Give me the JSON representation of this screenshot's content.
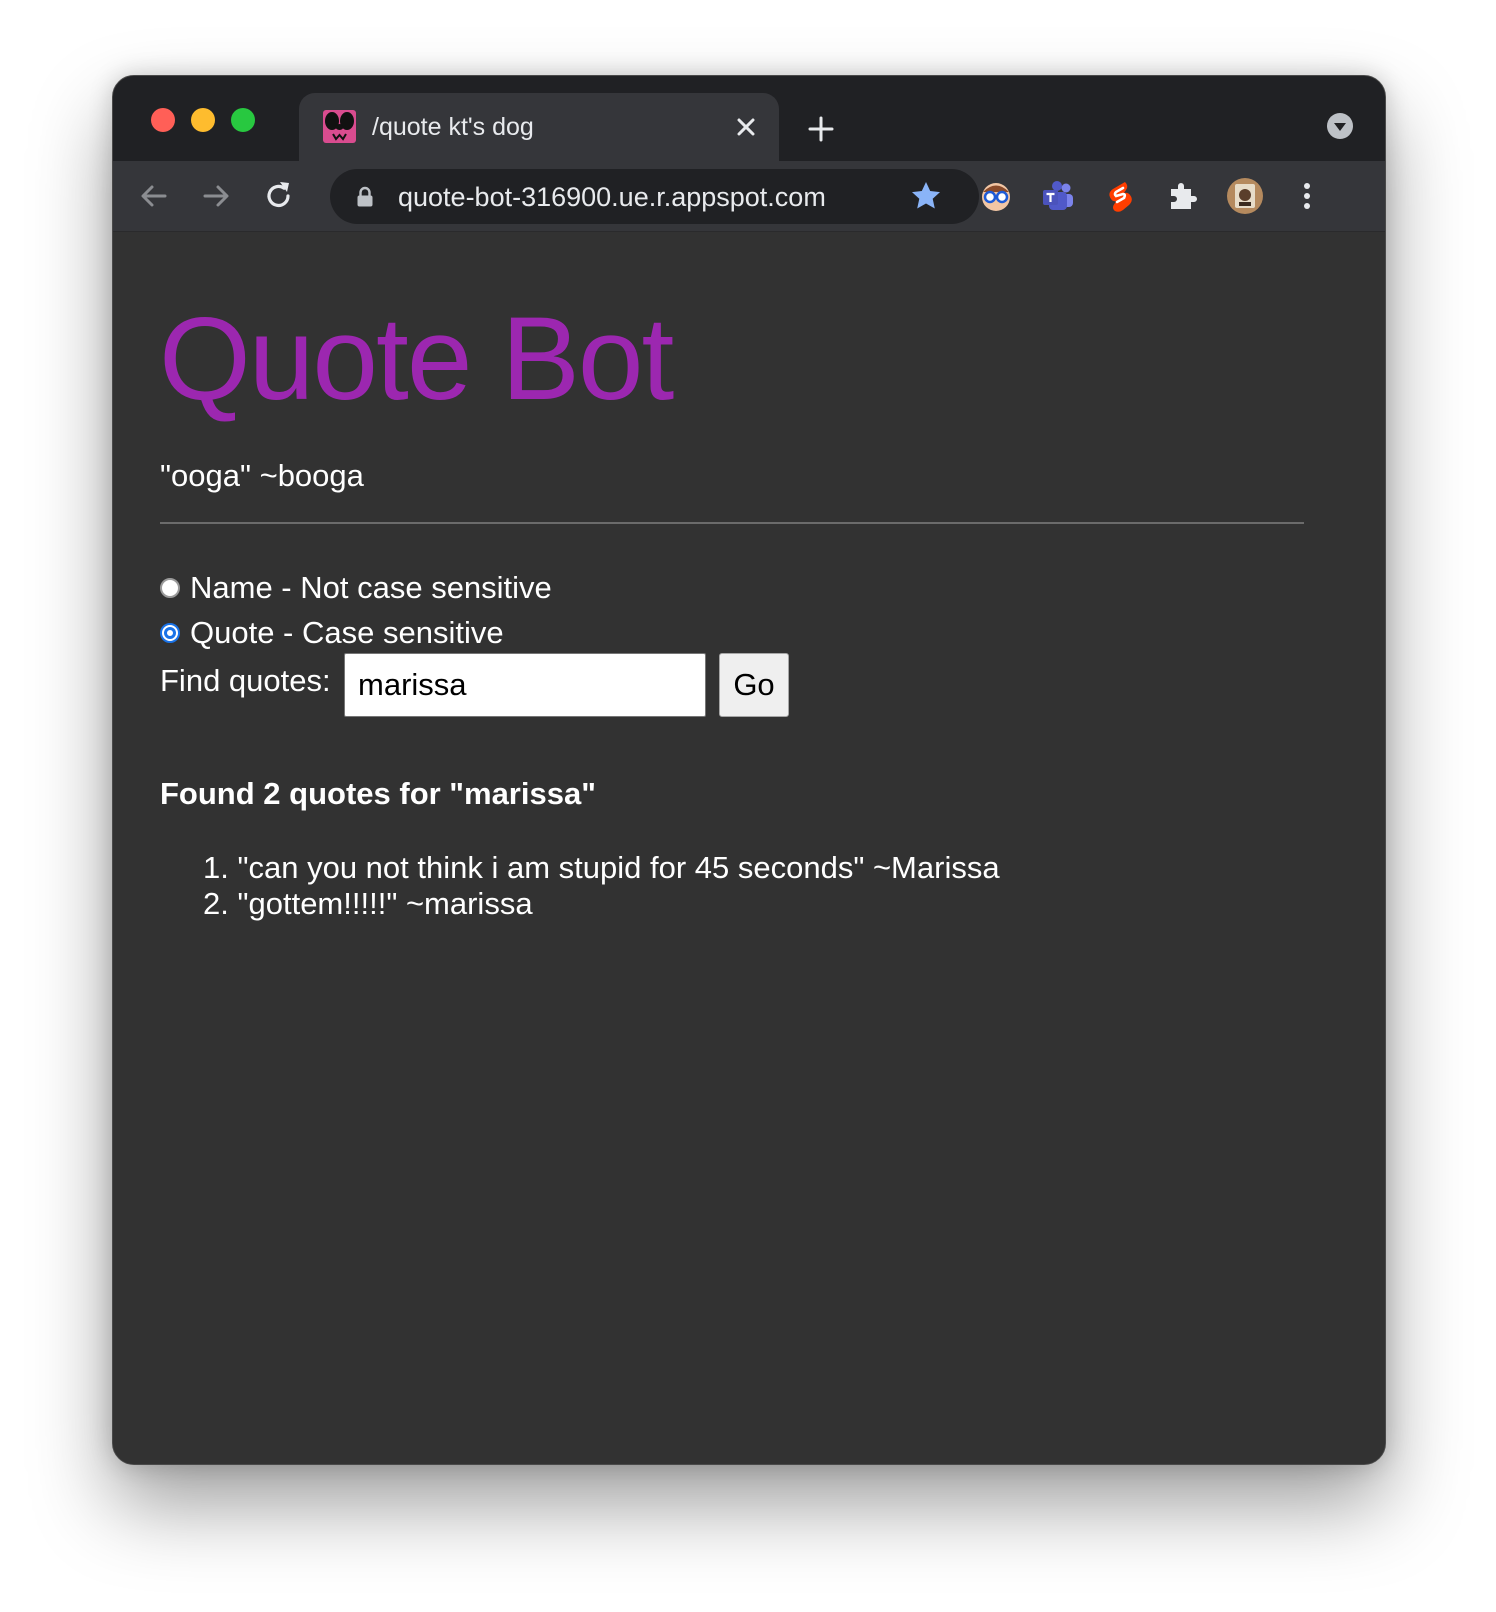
{
  "browser": {
    "tab": {
      "title": "/quote kt's dog",
      "favicon": "dog-face-icon"
    },
    "address_bar": {
      "url": "quote-bot-316900.ue.r.appspot.com"
    },
    "extensions": [
      "nerd-glasses-extension-icon",
      "teams-extension-icon",
      "svelte-extension-icon",
      "puzzle-extensions-icon",
      "profile-avatar"
    ],
    "colors": {
      "tabstrip": "#202124",
      "toolbar": "#35363a",
      "star": "#8ab4f8"
    }
  },
  "page": {
    "title": "Quote Bot",
    "title_color": "#9c27b0",
    "featured_quote": "\"ooga\" ~booga",
    "search_mode": {
      "options": [
        {
          "label": "Name - Not case sensitive",
          "checked": false
        },
        {
          "label": "Quote - Case sensitive",
          "checked": true
        }
      ]
    },
    "search": {
      "label": "Find quotes:",
      "value": "marissa",
      "button_label": "Go"
    },
    "results": {
      "heading": "Found 2 quotes for \"marissa\"",
      "items": [
        {
          "number": "1.",
          "text": "\"can you not think i am stupid for 45 seconds\" ~Marissa"
        },
        {
          "number": "2.",
          "text": "\"gottem!!!!!\" ~marissa"
        }
      ]
    }
  }
}
